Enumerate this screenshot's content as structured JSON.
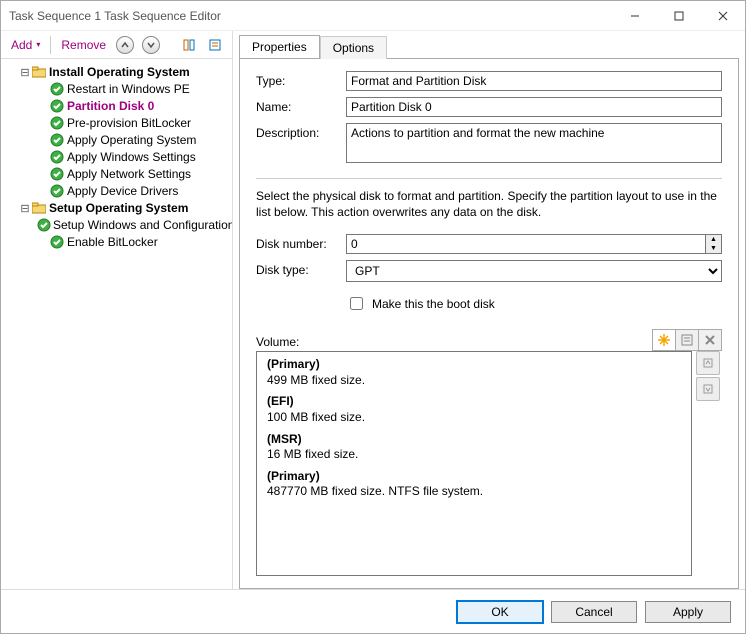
{
  "window": {
    "title": "Task Sequence 1 Task Sequence Editor"
  },
  "toolbar": {
    "add": "Add",
    "remove": "Remove"
  },
  "tree": {
    "groups": [
      {
        "label": "Install Operating System",
        "items": [
          {
            "label": "Restart in Windows PE",
            "selected": false
          },
          {
            "label": "Partition Disk 0",
            "selected": true
          },
          {
            "label": "Pre-provision BitLocker",
            "selected": false
          },
          {
            "label": "Apply Operating System",
            "selected": false
          },
          {
            "label": "Apply Windows Settings",
            "selected": false
          },
          {
            "label": "Apply Network Settings",
            "selected": false
          },
          {
            "label": "Apply Device Drivers",
            "selected": false
          }
        ]
      },
      {
        "label": "Setup Operating System",
        "items": [
          {
            "label": "Setup Windows and Configuration Manager",
            "selected": false
          },
          {
            "label": "Enable BitLocker",
            "selected": false
          }
        ]
      }
    ]
  },
  "tabs": {
    "properties": "Properties",
    "options": "Options"
  },
  "form": {
    "type_label": "Type:",
    "type_value": "Format and Partition Disk",
    "name_label": "Name:",
    "name_value": "Partition Disk 0",
    "desc_label": "Description:",
    "desc_value": "Actions to partition and format the new machine",
    "help": "Select the physical disk to format and partition. Specify the partition layout to use in the list below. This action overwrites any data on the disk.",
    "disknum_label": "Disk number:",
    "disknum_value": "0",
    "disktype_label": "Disk type:",
    "disktype_value": "GPT",
    "bootdisk_label": "Make this the boot disk",
    "volume_label": "Volume:"
  },
  "volumes": [
    {
      "name": "(Primary)",
      "detail": "499 MB fixed size."
    },
    {
      "name": "(EFI)",
      "detail": "100 MB fixed size."
    },
    {
      "name": "(MSR)",
      "detail": "16 MB fixed size."
    },
    {
      "name": "(Primary)",
      "detail": "487770 MB fixed size. NTFS file system."
    }
  ],
  "buttons": {
    "ok": "OK",
    "cancel": "Cancel",
    "apply": "Apply"
  }
}
